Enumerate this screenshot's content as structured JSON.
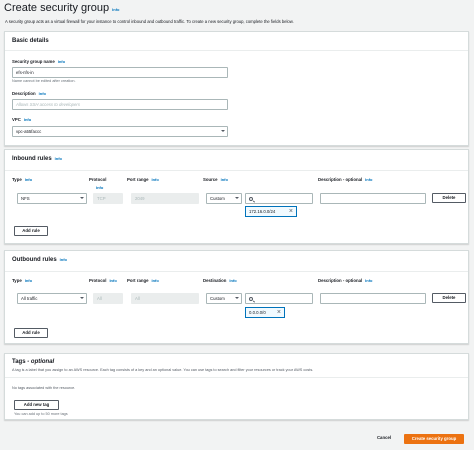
{
  "header": {
    "title": "Create security group",
    "info": "Info",
    "description": "A security group acts as a virtual firewall for your instance to control inbound and outbound traffic. To create a new security group, complete the fields below."
  },
  "basic": {
    "heading": "Basic details",
    "name_label": "Security group name",
    "name_info": "Info",
    "name_value": "efs-nfs-in",
    "name_hint": "Name cannot be edited after creation.",
    "desc_label": "Description",
    "desc_info": "Info",
    "desc_placeholder": "Allows SSH access to developers",
    "vpc_label": "VPC",
    "vpc_info": "Info",
    "vpc_value": "vpc-a55faccc"
  },
  "inbound": {
    "heading": "Inbound rules",
    "info": "Info",
    "columns": {
      "type": "Type",
      "type_info": "Info",
      "protocol": "Protocol",
      "protocol_info": "Info",
      "port": "Port range",
      "port_info": "Info",
      "source": "Source",
      "source_info": "Info",
      "desc": "Description - optional",
      "desc_info": "Info"
    },
    "row": {
      "type": "NFS",
      "protocol": "TCP",
      "port": "2049",
      "source": "Custom",
      "token": "172.16.0.0/24",
      "delete": "Delete"
    },
    "add_rule": "Add rule"
  },
  "outbound": {
    "heading": "Outbound rules",
    "info": "Info",
    "columns": {
      "type": "Type",
      "type_info": "Info",
      "protocol": "Protocol",
      "protocol_info": "Info",
      "port": "Port range",
      "port_info": "Info",
      "dest": "Destination",
      "dest_info": "Info",
      "desc": "Description - optional",
      "desc_info": "Info"
    },
    "row": {
      "type": "All traffic",
      "protocol": "All",
      "port": "All",
      "dest": "Custom",
      "token": "0.0.0.0/0",
      "delete": "Delete"
    },
    "add_rule": "Add rule"
  },
  "tags": {
    "heading": "Tags",
    "heading_suffix": "- optional",
    "description": "A tag is a label that you assign to an AWS resource. Each tag consists of a key and an optional value. You can use tags to search and filter your resources or track your AWS costs.",
    "empty": "No tags associated with the resource.",
    "add_tag": "Add new tag",
    "limit": "You can add up to 50 more tags"
  },
  "footer": {
    "cancel": "Cancel",
    "create": "Create security group"
  }
}
